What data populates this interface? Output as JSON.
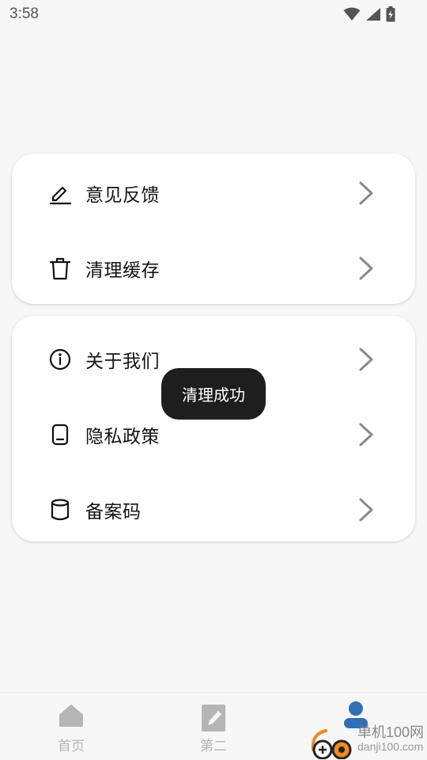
{
  "status_bar": {
    "time": "3:58",
    "icons": [
      "wifi-icon",
      "signal-icon",
      "battery-charging-icon"
    ]
  },
  "menu_group_1": {
    "items": [
      {
        "icon": "edit-icon",
        "label": "意见反馈"
      },
      {
        "icon": "trash-icon",
        "label": "清理缓存"
      }
    ]
  },
  "menu_group_2": {
    "items": [
      {
        "icon": "info-icon",
        "label": "关于我们"
      },
      {
        "icon": "document-icon",
        "label": "隐私政策"
      },
      {
        "icon": "cylinder-icon",
        "label": "备案码"
      }
    ]
  },
  "toast": {
    "message": "清理成功"
  },
  "bottom_nav": {
    "items": [
      {
        "icon": "home-icon",
        "label": "首页",
        "active": false
      },
      {
        "icon": "edit-doc-icon",
        "label": "第二",
        "active": false
      },
      {
        "icon": "person-icon",
        "label": "",
        "active": true
      }
    ]
  },
  "watermark": {
    "title": "单机100网",
    "url": "danji100.com"
  },
  "colors": {
    "background": "#f7f7f7",
    "card": "#ffffff",
    "toast_bg": "#1e1e1e",
    "nav_active": "#2f6fb5",
    "nav_inactive": "#b5b5b5",
    "chevron": "#8a8a8a"
  }
}
